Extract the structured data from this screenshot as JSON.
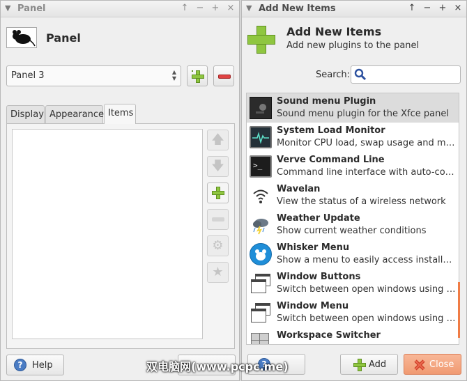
{
  "panel_window": {
    "title": "Panel",
    "heading": "Panel",
    "panel_select": "Panel 3",
    "tabs": [
      "Display",
      "Appearance",
      "Items"
    ],
    "help_label": "Help"
  },
  "add_window": {
    "title": "Add New Items",
    "heading": "Add New Items",
    "subheading": "Add new plugins to the panel",
    "search_label": "Search:",
    "search_value": "",
    "plugins": [
      {
        "name": "Sound menu Plugin",
        "desc": "Sound menu plugin for the Xfce panel",
        "icon": "sound-menu-icon",
        "selected": true
      },
      {
        "name": "System Load Monitor",
        "desc": "Monitor CPU load, swap usage and mem...",
        "icon": "system-load-icon"
      },
      {
        "name": "Verve Command Line",
        "desc": "Command line interface with auto-compl...",
        "icon": "terminal-icon"
      },
      {
        "name": "Wavelan",
        "desc": "View the status of a wireless network",
        "icon": "wifi-icon"
      },
      {
        "name": "Weather Update",
        "desc": "Show current weather conditions",
        "icon": "weather-icon"
      },
      {
        "name": "Whisker Menu",
        "desc": "Show a menu to easily access installed ap...",
        "icon": "whisker-icon"
      },
      {
        "name": "Window Buttons",
        "desc": "Switch between open windows using butt...",
        "icon": "window-buttons-icon"
      },
      {
        "name": "Window Menu",
        "desc": "Switch between open windows using a m...",
        "icon": "window-menu-icon"
      },
      {
        "name": "Workspace Switcher",
        "desc": "",
        "icon": "workspace-icon"
      }
    ],
    "add_label": "Add",
    "close_label": "Close",
    "help_label": "Help"
  },
  "watermark": "双电脑网(www.pcpc.me)",
  "colors": {
    "accent_green": "#8fc640",
    "danger_red": "#e04343",
    "close_button": "#f5a886",
    "scrollbar_accent": "#f07c45"
  }
}
